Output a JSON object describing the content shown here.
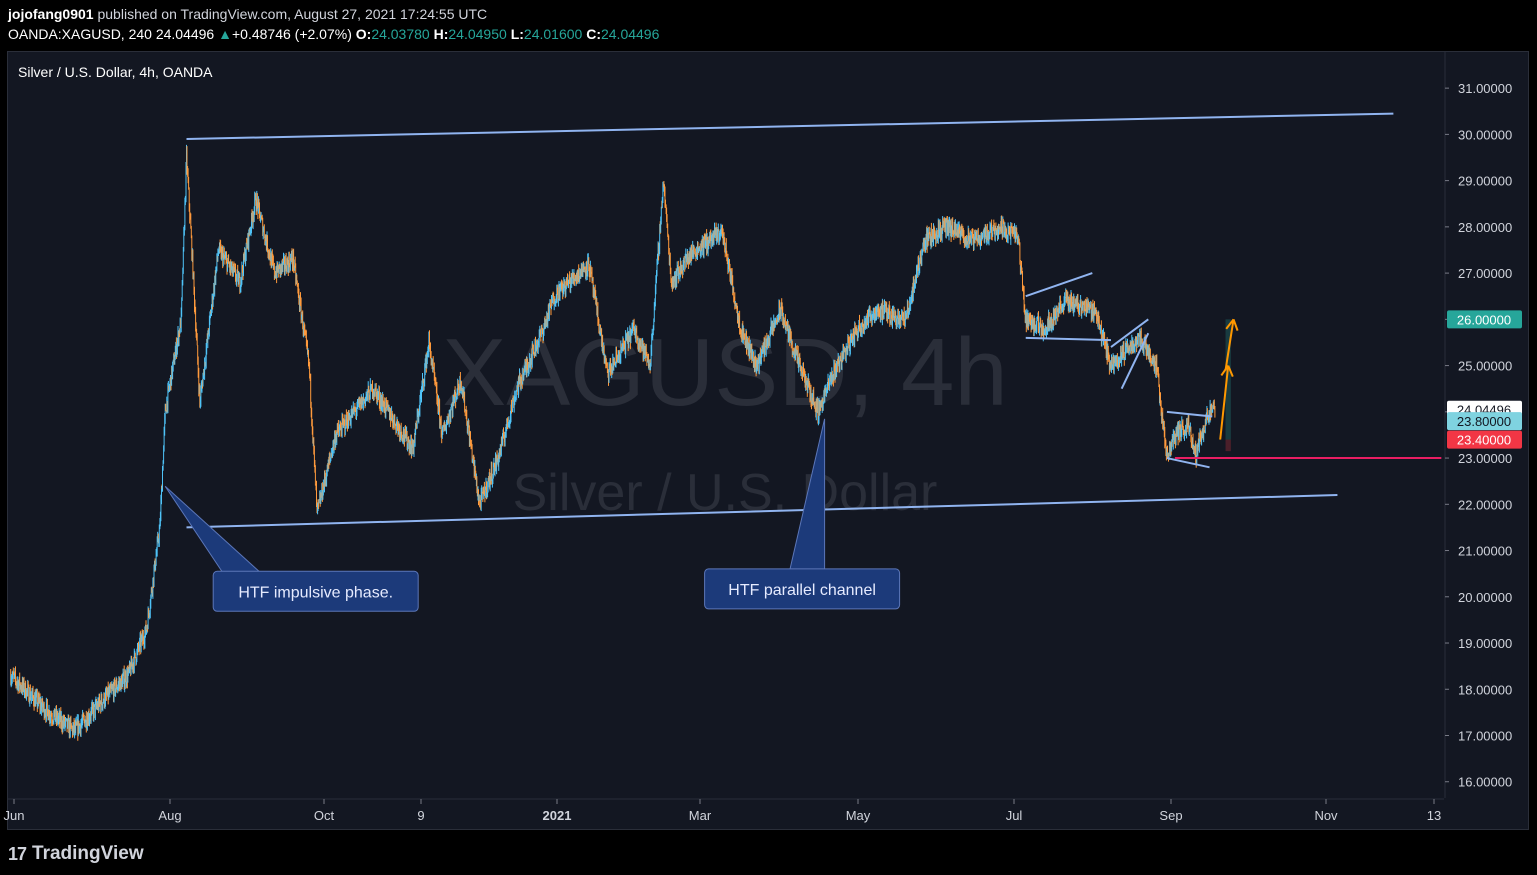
{
  "header": {
    "author": "jojofang0901",
    "published_text": "published on TradingView.com, August 27, 2021 17:24:55 UTC",
    "symbol": "OANDA:XAGUSD, 240",
    "last": "24.04496",
    "change_arrow": "▲",
    "change": "+0.48746 (+2.07%)",
    "o_label": "O:",
    "o_value": "24.03780",
    "h_label": "H:",
    "h_value": "24.04950",
    "l_label": "L:",
    "l_value": "24.01600",
    "c_label": "C:",
    "c_value": "24.04496"
  },
  "footer": {
    "brand": "TradingView",
    "logo_icon": "tradingview-logo-icon"
  },
  "chart_data": {
    "type": "candlestick",
    "title": "Silver / U.S. Dollar, 4h, OANDA",
    "watermark_symbol": "XAGUSD, 4h",
    "watermark_name": "Silver / U.S. Dollar",
    "ylim": [
      15.6,
      31.5
    ],
    "y_ticks": [
      "31.00000",
      "30.00000",
      "29.00000",
      "28.00000",
      "27.00000",
      "26.00000",
      "25.00000",
      "24.00000",
      "23.00000",
      "22.00000",
      "21.00000",
      "20.00000",
      "19.00000",
      "18.00000",
      "17.00000",
      "16.00000"
    ],
    "y_tick_values": [
      31,
      30,
      29,
      28,
      27,
      26,
      25,
      24,
      23,
      22,
      21,
      20,
      19,
      18,
      17,
      16
    ],
    "x_ticks": [
      "Jun",
      "Aug",
      "Oct",
      "9",
      "2021",
      "Mar",
      "May",
      "Jul",
      "Sep",
      "Nov",
      "13"
    ],
    "x_tick_bold": [
      "2021"
    ],
    "price_labels": [
      {
        "text": "26.00000",
        "value": 26.0,
        "color": "#26a69a"
      },
      {
        "text": "24.04496",
        "value": 24.045,
        "color": "#ffffff"
      },
      {
        "text": "23.80000",
        "value": 23.8,
        "color": "#7fd3e0"
      },
      {
        "text": "23.40000",
        "value": 23.4,
        "color": "#f23645"
      }
    ],
    "anchors": [
      [
        "2020-06-01",
        18.3
      ],
      [
        "2020-06-15",
        17.5
      ],
      [
        "2020-06-25",
        17.1
      ],
      [
        "2020-07-08",
        17.9
      ],
      [
        "2020-07-15",
        18.3
      ],
      [
        "2020-07-22",
        19.3
      ],
      [
        "2020-07-27",
        21.5
      ],
      [
        "2020-07-29",
        24.0
      ],
      [
        "2020-08-04",
        26.0
      ],
      [
        "2020-08-06",
        29.5
      ],
      [
        "2020-08-08",
        27.5
      ],
      [
        "2020-08-11",
        24.2
      ],
      [
        "2020-08-18",
        27.5
      ],
      [
        "2020-08-26",
        26.8
      ],
      [
        "2020-09-01",
        28.6
      ],
      [
        "2020-09-08",
        27.0
      ],
      [
        "2020-09-15",
        27.3
      ],
      [
        "2020-09-21",
        25.0
      ],
      [
        "2020-09-24",
        21.8
      ],
      [
        "2020-10-01",
        23.5
      ],
      [
        "2020-10-15",
        24.5
      ],
      [
        "2020-10-30",
        23.2
      ],
      [
        "2020-11-05",
        25.5
      ],
      [
        "2020-11-10",
        23.5
      ],
      [
        "2020-11-17",
        24.7
      ],
      [
        "2020-11-24",
        22.0
      ],
      [
        "2020-12-01",
        23.0
      ],
      [
        "2020-12-08",
        24.5
      ],
      [
        "2020-12-18",
        25.8
      ],
      [
        "2020-12-22",
        26.5
      ],
      [
        "2021-01-04",
        27.2
      ],
      [
        "2021-01-11",
        24.8
      ],
      [
        "2021-01-21",
        25.8
      ],
      [
        "2021-01-27",
        25.0
      ],
      [
        "2021-02-01",
        29.0
      ],
      [
        "2021-02-04",
        26.8
      ],
      [
        "2021-02-11",
        27.4
      ],
      [
        "2021-02-23",
        27.9
      ],
      [
        "2021-03-02",
        25.8
      ],
      [
        "2021-03-08",
        25.0
      ],
      [
        "2021-03-17",
        26.2
      ],
      [
        "2021-03-24",
        25.0
      ],
      [
        "2021-03-31",
        24.0
      ],
      [
        "2021-04-07",
        25.0
      ],
      [
        "2021-04-15",
        25.8
      ],
      [
        "2021-04-22",
        26.2
      ],
      [
        "2021-05-03",
        26.0
      ],
      [
        "2021-05-10",
        27.7
      ],
      [
        "2021-05-18",
        28.0
      ],
      [
        "2021-05-28",
        27.7
      ],
      [
        "2021-06-07",
        28.0
      ],
      [
        "2021-06-14",
        27.8
      ],
      [
        "2021-06-17",
        26.0
      ],
      [
        "2021-06-24",
        25.8
      ],
      [
        "2021-07-02",
        26.4
      ],
      [
        "2021-07-13",
        26.2
      ],
      [
        "2021-07-19",
        25.0
      ],
      [
        "2021-07-26",
        25.4
      ],
      [
        "2021-07-30",
        25.6
      ],
      [
        "2021-08-05",
        25.0
      ],
      [
        "2021-08-09",
        23.0
      ],
      [
        "2021-08-12",
        23.5
      ],
      [
        "2021-08-17",
        23.7
      ],
      [
        "2021-08-20",
        23.1
      ],
      [
        "2021-08-24",
        23.9
      ],
      [
        "2021-08-27",
        24.04
      ]
    ],
    "trendlines": [
      {
        "name": "channel-top",
        "x1": "2020-08-06",
        "y1": 29.9,
        "x2": "2021-11-02",
        "y2": 30.45,
        "color": "#90b4f0"
      },
      {
        "name": "channel-bottom",
        "x1": "2020-08-06",
        "y1": 21.5,
        "x2": "2021-10-12",
        "y2": 22.2,
        "color": "#90b4f0"
      },
      {
        "name": "flag1-top",
        "x1": "2021-06-17",
        "y1": 26.5,
        "x2": "2021-07-12",
        "y2": 27.0,
        "color": "#90b4f0"
      },
      {
        "name": "flag1-bottom",
        "x1": "2021-06-17",
        "y1": 25.6,
        "x2": "2021-07-19",
        "y2": 25.55,
        "color": "#90b4f0"
      },
      {
        "name": "flag2-top",
        "x1": "2021-07-19",
        "y1": 25.4,
        "x2": "2021-08-02",
        "y2": 26.0,
        "color": "#90b4f0"
      },
      {
        "name": "flag2-bottom",
        "x1": "2021-07-23",
        "y1": 24.5,
        "x2": "2021-08-02",
        "y2": 25.7,
        "color": "#90b4f0"
      },
      {
        "name": "wedge-top",
        "x1": "2021-08-09",
        "y1": 24.0,
        "x2": "2021-08-26",
        "y2": 23.9,
        "color": "#90b4f0"
      },
      {
        "name": "wedge-bottom",
        "x1": "2021-08-09",
        "y1": 23.0,
        "x2": "2021-08-25",
        "y2": 22.8,
        "color": "#90b4f0"
      },
      {
        "name": "support-23",
        "x1": "2021-08-12",
        "y1": 23.0,
        "x2": "2021-11-20",
        "y2": 23.0,
        "color": "#e91e63"
      }
    ],
    "arrows": [
      {
        "name": "target-arrow-1",
        "x1": "2021-08-29",
        "y1": 23.4,
        "x2": "2021-09-01",
        "y2": 25.0,
        "color": "#ff9800"
      },
      {
        "name": "target-arrow-2",
        "x1": "2021-08-31",
        "y1": 24.9,
        "x2": "2021-09-03",
        "y2": 26.0,
        "color": "#ff9800"
      }
    ],
    "position": {
      "x1": "2021-08-31",
      "x2": "2021-09-02",
      "entry": 23.4,
      "target": 26.0,
      "stop": 23.15
    },
    "callouts": [
      {
        "text": "HTF impulsive phase.",
        "x": "2020-07-29",
        "y": 21.2
      },
      {
        "text": "HTF parallel channel",
        "x": "2021-03-26",
        "y": 21.9
      }
    ]
  }
}
